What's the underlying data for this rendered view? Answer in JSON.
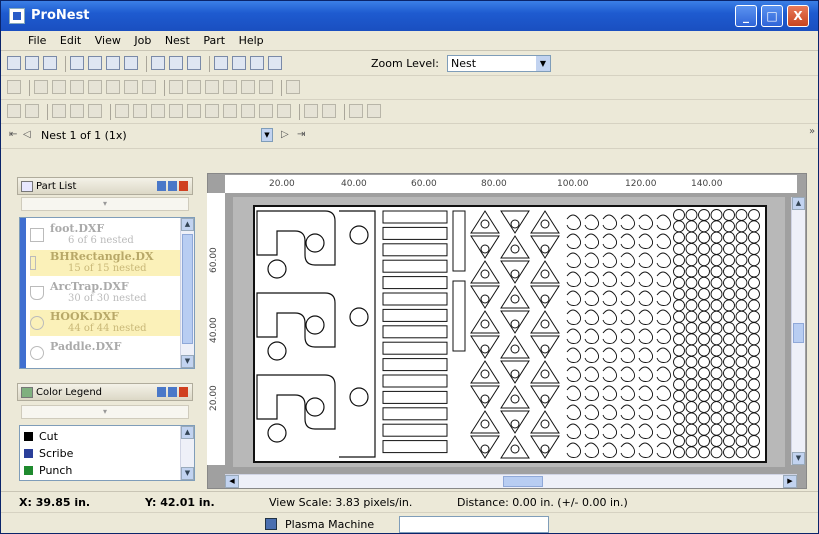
{
  "window": {
    "title": "ProNest",
    "min_label": "_",
    "max_label": "□",
    "close_label": "X"
  },
  "menu": [
    "File",
    "Edit",
    "View",
    "Job",
    "Nest",
    "Part",
    "Help"
  ],
  "toolbar": {
    "zoom_label": "Zoom Level:",
    "zoom_value": "Nest"
  },
  "nest_nav": {
    "current": "Nest 1 of 1 (1x)"
  },
  "part_list": {
    "title": "Part List",
    "items": [
      {
        "name": "foot.DXF",
        "count": "6 of 6 nested",
        "highlight": false
      },
      {
        "name": "BHRectangle.DX",
        "count": "15 of 15 nested",
        "highlight": true
      },
      {
        "name": "ArcTrap.DXF",
        "count": "30 of 30 nested",
        "highlight": false
      },
      {
        "name": "HOOK.DXF",
        "count": "44 of 44 nested",
        "highlight": true
      },
      {
        "name": "Paddle.DXF",
        "count": "",
        "highlight": false
      }
    ]
  },
  "color_legend": {
    "title": "Color Legend",
    "items": [
      {
        "label": "Cut",
        "color": "#000000"
      },
      {
        "label": "Scribe",
        "color": "#2b3f9a"
      },
      {
        "label": "Punch",
        "color": "#1f8a2e"
      }
    ]
  },
  "ruler": {
    "top": [
      "20.00",
      "40.00",
      "60.00",
      "80.00",
      "100.00",
      "120.00",
      "140.00"
    ],
    "left": [
      "60.00",
      "40.00",
      "20.00"
    ]
  },
  "status": {
    "x": "X: 39.85 in.",
    "y": "Y: 42.01 in.",
    "view_scale": "View Scale: 3.83 pixels/in.",
    "distance": "Distance: 0.00 in. (+/- 0.00 in.)"
  },
  "machine": {
    "name": "Plasma Machine"
  }
}
